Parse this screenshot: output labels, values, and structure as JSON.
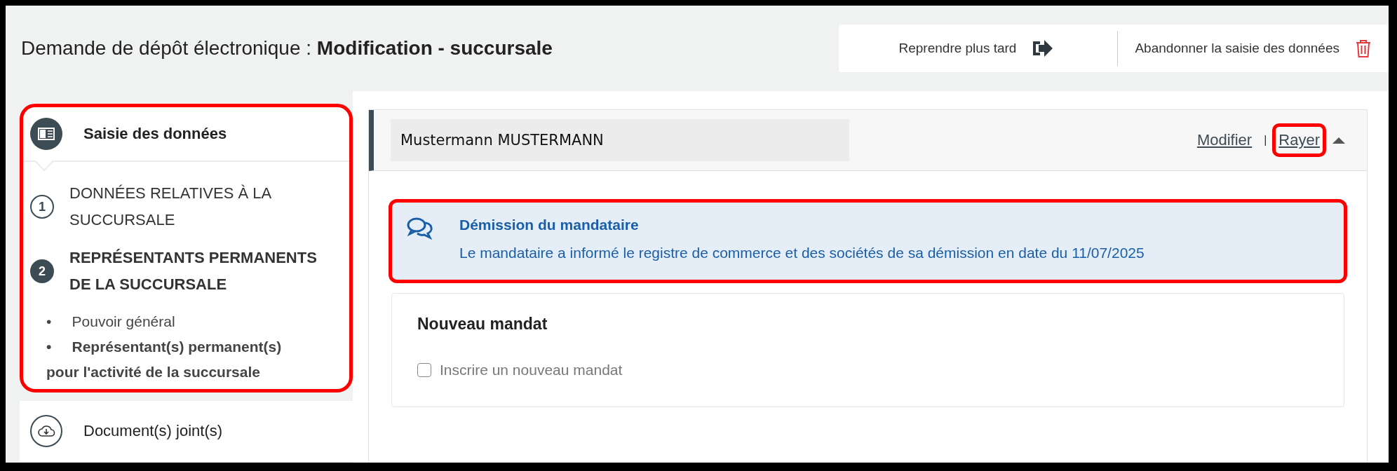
{
  "header": {
    "title_prefix": "Demande de dépôt électronique : ",
    "title_bold": "Modification - succursale",
    "actions": [
      {
        "label": "Reprendre plus tard",
        "kind": "resume"
      },
      {
        "label": "Abandonner la saisie des données",
        "kind": "abandon"
      }
    ]
  },
  "sidebar": {
    "sections": [
      {
        "title": "Saisie des données",
        "kind": "data",
        "expanded": true,
        "highlighted": true,
        "steps": [
          {
            "number": "1",
            "label": "DONNÉES RELATIVES À LA SUCCURSALE",
            "selected": false
          },
          {
            "number": "2",
            "label": "REPRÉSENTANTS PERMANENTS DE LA SUCCURSALE",
            "selected": true,
            "items": [
              {
                "bullet": "•",
                "label": "Pouvoir général",
                "selected": false
              },
              {
                "bullet": "•",
                "label": "Représentant(s) permanent(s) pour l'activité de la succursale",
                "selected": true
              }
            ]
          }
        ]
      },
      {
        "title": "Document(s) joint(s)",
        "kind": "documents",
        "expanded": false,
        "highlighted": false
      }
    ]
  },
  "person": {
    "name": "Mustermann  MUSTERMANN",
    "expanded": true,
    "links": [
      {
        "label": "Modifier",
        "highlighted": false,
        "separator": "|"
      },
      {
        "label": "Rayer",
        "highlighted": true
      }
    ],
    "notice": {
      "title": "Démission du mandataire",
      "text": "Le mandataire a informé le registre de commerce et des sociétés de sa démission en date du 11/07/2025",
      "highlighted": true
    },
    "new_mandate": {
      "title": "Nouveau mandat",
      "checkbox": {
        "label": "Inscrire un nouveau mandat",
        "checked": false
      }
    }
  }
}
